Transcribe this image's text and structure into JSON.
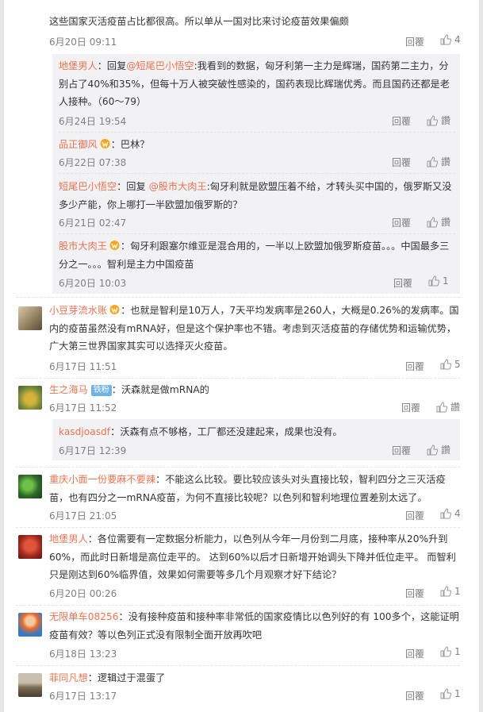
{
  "colors": {
    "name": "#eb7350",
    "meta": "#808080",
    "reply_bg": "#f2f2f5"
  },
  "labels": {
    "reply": "回覆",
    "report": "讚"
  },
  "top_comment": {
    "text": "这些国家灭活疫苗占比都很高。所以单从一国对比来讨论疫苗效果偏颇",
    "time": "6月20日 09:11",
    "likes": "4"
  },
  "replies": [
    {
      "user": "地堡男人",
      "prefix": "：回复",
      "mention": "@短尾巴小悟空",
      "text": ":我看到的数据，匈牙利第一主力是辉瑞，国药第二主力，分别占了40%和35%，但每十万人被突破性感染的，国药表现比辉瑞优秀。而且国药还都是老人接种。（60～79）",
      "time": "6月24日 19:54",
      "like_label": "讚"
    },
    {
      "user": "品正御风",
      "text": "：巴林？",
      "time": "6月22日 07:38",
      "like_label": "讚"
    },
    {
      "user": "短尾巴小悟空",
      "prefix": "：回复 ",
      "mention": "@股市大肉王",
      "text": ":匈牙利就是欧盟压着不给，才转头买中国的，俄罗斯又没多少产能，你上哪打一半欧盟加俄罗斯的？",
      "time": "6月21日 02:47",
      "like_label": "讚"
    },
    {
      "user": "股市大肉王",
      "text": "：匈牙利跟塞尔维亚是混合用的，一半以上欧盟加俄罗斯疫苗。。。中国最多三分之一。。。智利是主力中国疫苗",
      "time": "6月20日 10:03",
      "likes": "1"
    }
  ],
  "comments": [
    {
      "user": "小豆芽流水账",
      "text": "：也就是智利是10万人，7天平均发病率是260人，大概是0.26%的发病率。国内的疫苗虽然没有mRNA好，但是这个保护率也不错。考虑到灭活疫苗的存储优势和运输优势，广大第三世界国家其实可以选择灭火疫苗。",
      "time": "6月17日 11:51",
      "likes": "5"
    },
    {
      "user": "生之海马",
      "badge": "铁粉",
      "text": "：沃森就是做mRNA的",
      "time": "6月17日 11:52",
      "like_label": "讚",
      "reply": {
        "user": "kasdjoasdf",
        "text": "：沃森有点不够格，工厂都还没建起来，成果也没有。",
        "time": "6月17日 12:39",
        "like_label": "讚"
      }
    },
    {
      "user": "重庆小面一份要麻不要辣",
      "text": "：不能这么比较。要比较应该头对头直接比较，智利四分之三灭活疫苗，也有四分之一mRNA疫苗，为何不直接比较呢？以色列和智利地理位置差别太远了。",
      "time": "6月17日 21:05",
      "likes": "4"
    },
    {
      "user": "地堡男人",
      "text": "：各位需要有一定数据分析能力，以色列从今年一月份到二月底，接种率从20%升到60%，而此时日新增是高位走平的。 达到60%以后才日新增开始调头下降并低位走平。 而智利只是刚达到60%临界值，效果如何需要等多几个月观察才好下结论？",
      "time": "6月20日 00:26",
      "likes": "1"
    },
    {
      "user": "无限单车08256",
      "text": "：没有接种疫苗和接种率非常低的国家疫情比以色列好的有 100多个，这能证明疫苗有效？等以色列正式没有限制全面开放再吹吧",
      "time": "6月18日 13:23",
      "likes": "1"
    },
    {
      "user": "菲同凡想",
      "text": "：逻辑过于混蛋了",
      "time": "6月17日 13:17",
      "likes": "1"
    }
  ]
}
